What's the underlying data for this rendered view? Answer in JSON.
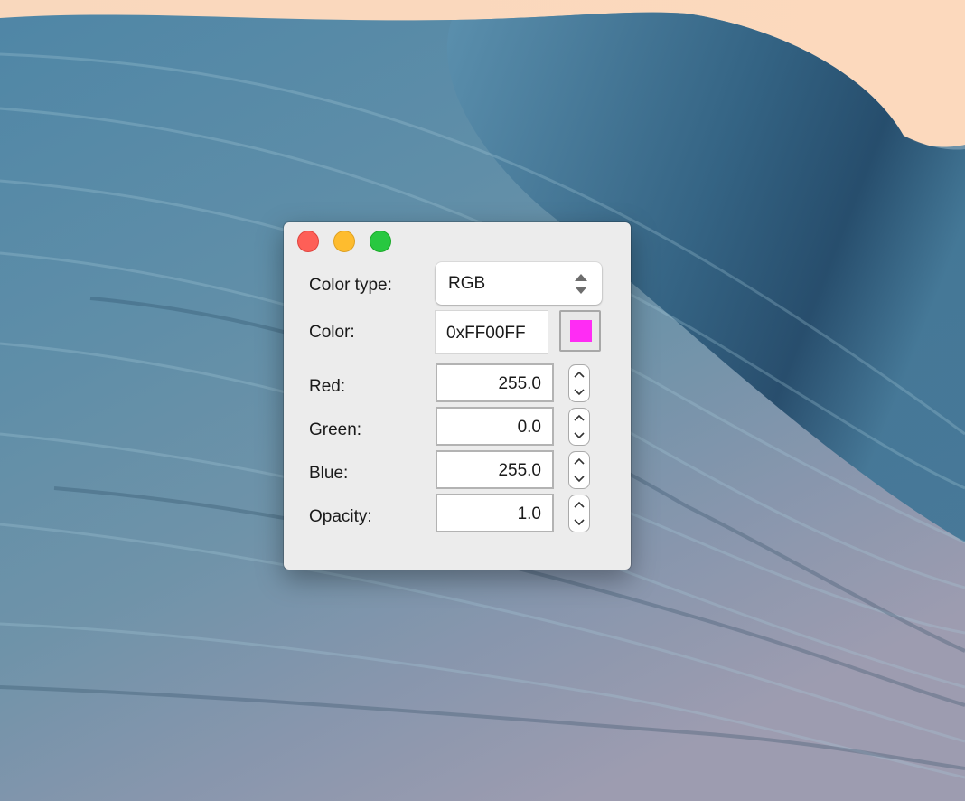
{
  "window": {
    "controls": {
      "close": "close-icon",
      "minimize": "minimize-icon",
      "zoom": "zoom-icon"
    }
  },
  "form": {
    "color_type": {
      "label": "Color type:",
      "value": "RGB"
    },
    "color": {
      "label": "Color:",
      "value": "0xFF00FF",
      "swatch_color": "#ff2cf4"
    },
    "fields": [
      {
        "label": "Red:",
        "value": "255.0"
      },
      {
        "label": "Green:",
        "value": "0.0"
      },
      {
        "label": "Blue:",
        "value": "255.0"
      },
      {
        "label": "Opacity:",
        "value": "1.0"
      }
    ]
  },
  "colors": {
    "close": "#fe5f57",
    "minimize": "#febc2e",
    "zoom": "#28c840"
  }
}
